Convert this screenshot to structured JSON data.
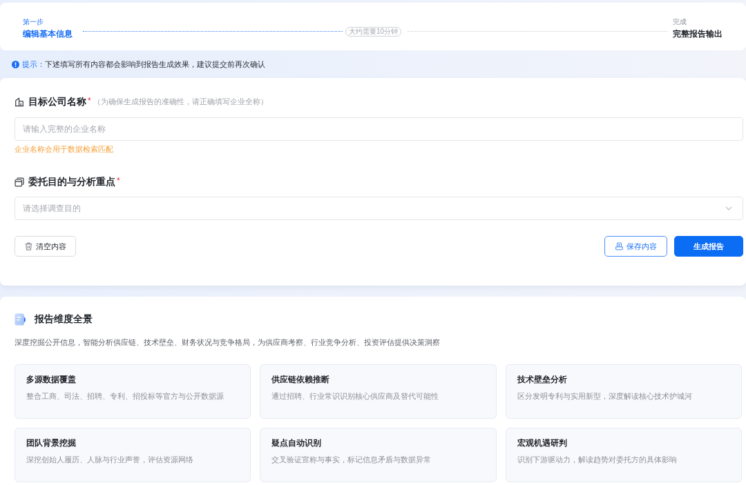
{
  "steps": [
    {
      "caption": "第一步",
      "title": "编辑基本信息",
      "active": true
    },
    {
      "caption": "完成",
      "title": "完整报告输出",
      "active": false
    }
  ],
  "duration": "大约需要10分钟",
  "hint": {
    "label": "提示：",
    "text": "下述填写所有内容都会影响到报告生成效果，建议提交前再次确认"
  },
  "form": {
    "fields": [
      {
        "kind": "text",
        "label": "目标公司名称",
        "required_mark": "*",
        "note": "（为确保生成报告的准确性，请正确填写企业全称）",
        "placeholder": "请输入完整的企业名称",
        "helper": "企业名称会用于数据检索匹配"
      },
      {
        "kind": "select",
        "label": "委托目的与分析重点",
        "required_mark": "*",
        "placeholder": "请选择调查目的"
      }
    ],
    "left_buttons": [
      {
        "kind": "default",
        "label": "清空内容"
      }
    ],
    "right_buttons": [
      {
        "kind": "outline",
        "label": "保存内容"
      },
      {
        "kind": "primary",
        "label": "生成报告"
      }
    ]
  },
  "overview": {
    "title": "报告维度全景",
    "description": "深度挖掘公开信息，智能分析供应链、技术壁垒、财务状况与竞争格局，为供应商考察、行业竞争分析、投资评估提供决策洞察",
    "cards": [
      {
        "title": "多源数据覆盖",
        "text": "整合工商、司法、招聘、专利、招投标等官方与公开数据源"
      },
      {
        "title": "供应链依赖推断",
        "text": "通过招聘、行业常识识别核心供应商及替代可能性"
      },
      {
        "title": "技术壁垒分析",
        "text": "区分发明专利与实用新型，深度解读核心技术护城河"
      },
      {
        "title": "团队背景挖掘",
        "text": "深挖创始人履历、人脉与行业声誉，评估资源网络"
      },
      {
        "title": "疑点自动识别",
        "text": "交叉验证宣称与事实，标记信息矛盾与数据异常"
      },
      {
        "title": "宏观机遇研判",
        "text": "识别下游驱动力，解读趋势对委托方的具体影响"
      }
    ]
  }
}
